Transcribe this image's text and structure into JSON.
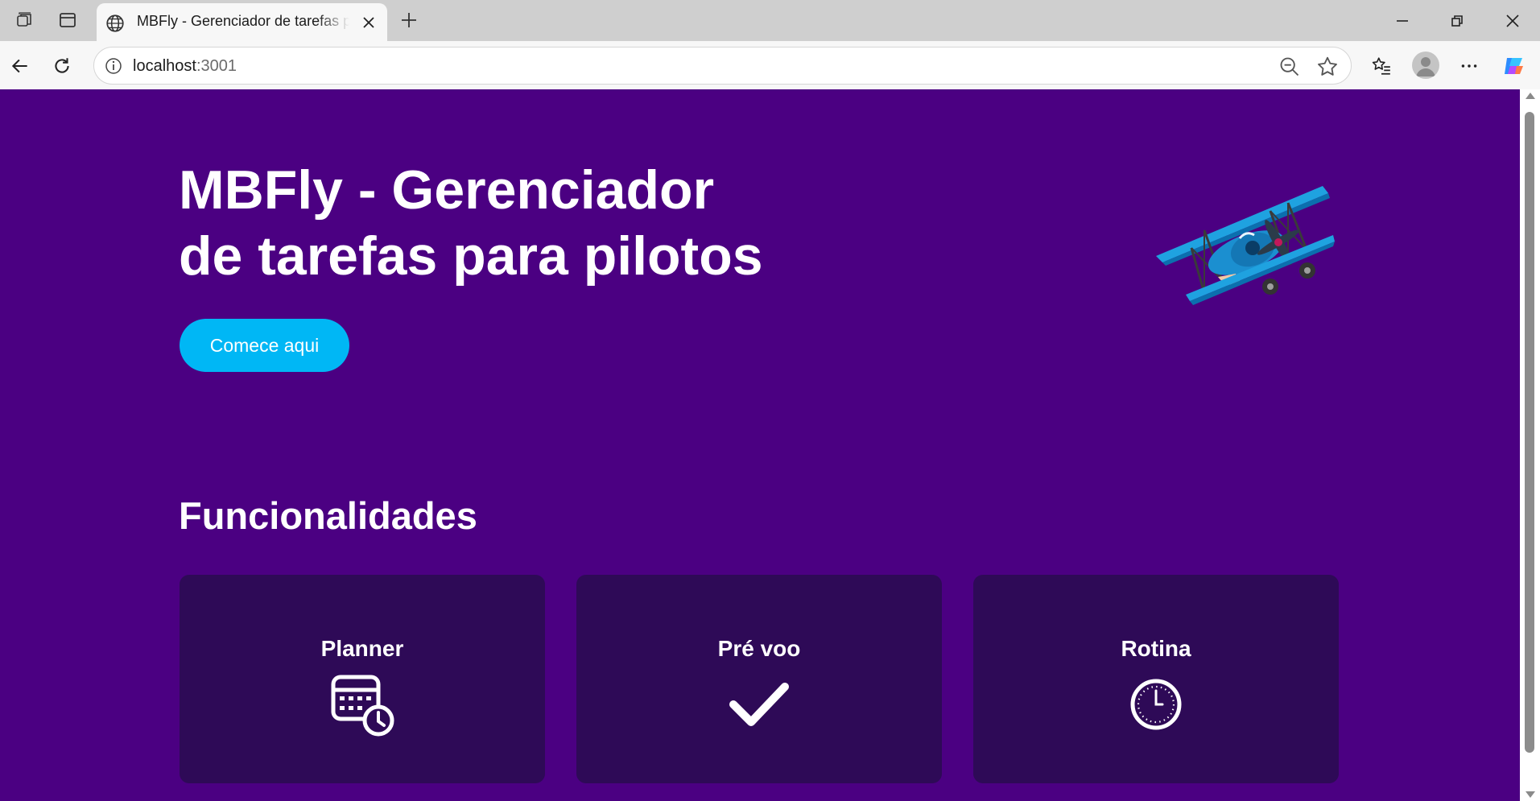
{
  "browser": {
    "tab": {
      "title": "MBFly - Gerenciador de tarefas para pilotos"
    },
    "address": {
      "host": "localhost",
      "port": ":3001"
    }
  },
  "hero": {
    "title_line1": "MBFly - Gerenciador",
    "title_line2": "de tarefas para pilotos",
    "cta_label": "Comece aqui"
  },
  "features": {
    "title": "Funcionalidades",
    "cards": [
      {
        "label": "Planner",
        "icon": "calendar-clock-icon"
      },
      {
        "label": "Pré voo",
        "icon": "checkmark-icon"
      },
      {
        "label": "Rotina",
        "icon": "clock-icon"
      }
    ]
  },
  "colors": {
    "page_bg": "#4b0082",
    "card_bg": "#2e0a57",
    "cta_bg": "#00b7f5",
    "text": "#ffffff"
  }
}
